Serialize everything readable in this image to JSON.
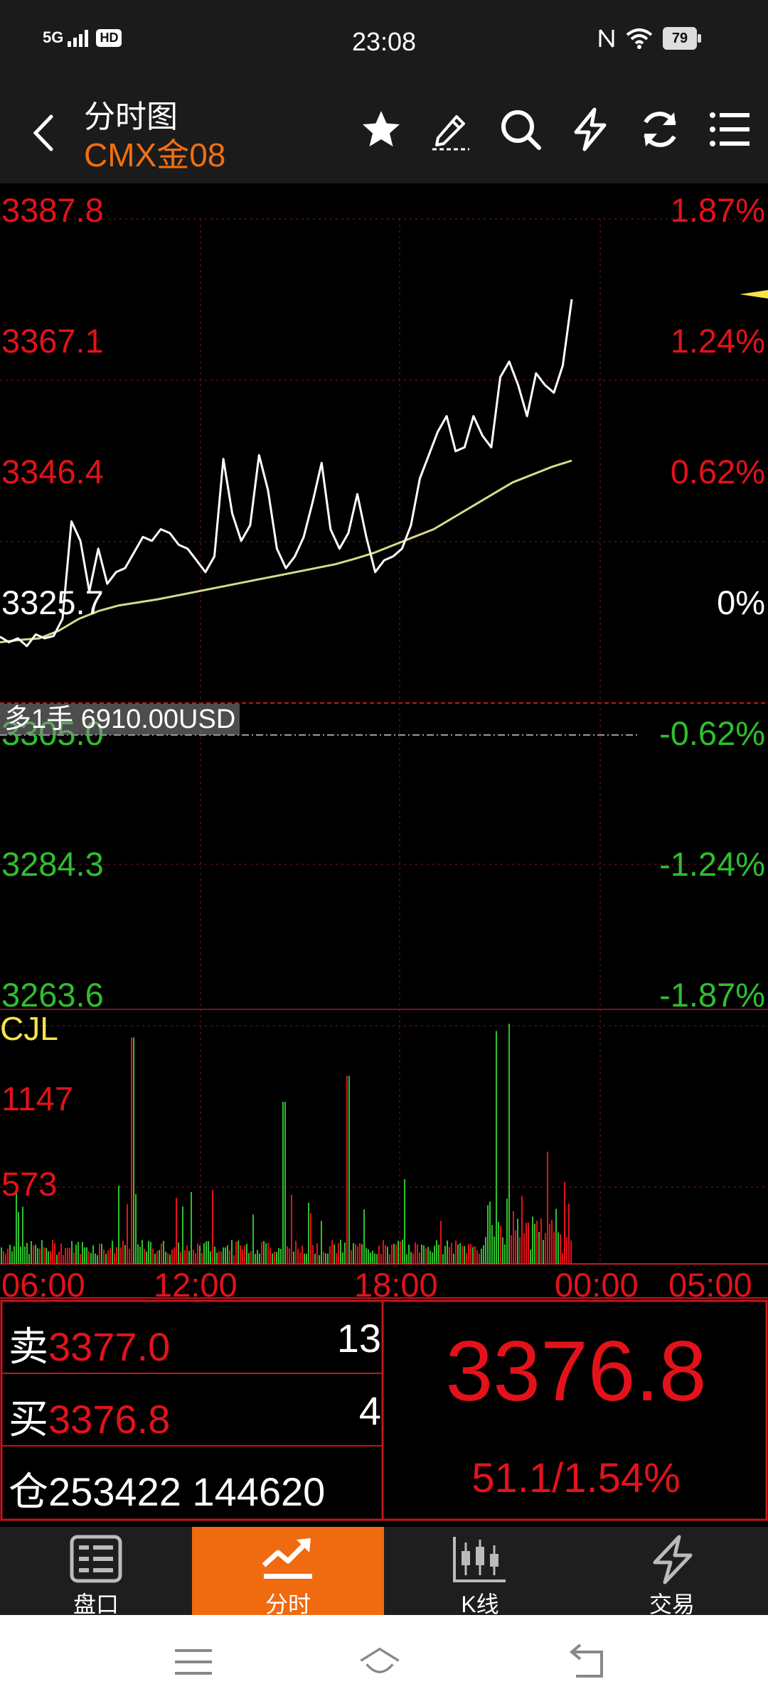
{
  "status_bar": {
    "network": "5G",
    "hd": "HD",
    "time": "23:08",
    "battery": "79"
  },
  "nav": {
    "title": "分时图",
    "subtitle": "CMX金08"
  },
  "chart": {
    "price_axis_left": [
      "3387.8",
      "3367.1",
      "3346.4",
      "3325.7",
      "3305.0",
      "3284.3",
      "3263.6"
    ],
    "percent_axis_right": [
      "1.87%",
      "1.24%",
      "0.62%",
      "0%",
      "-0.62%",
      "-1.24%",
      "-1.87%"
    ],
    "position_tag": "多1手  6910.00USD",
    "volume_label": "CJL",
    "volume_axis": [
      "1147",
      "573"
    ],
    "time_axis": [
      "06:00",
      "12:00",
      "18:00",
      "00:00",
      "05:00"
    ],
    "colors": {
      "up": "#e3121a",
      "down": "#2fbf2f",
      "price_line": "#ffffff",
      "avg_line": "#d7d98a",
      "accent": "#f06a0f"
    }
  },
  "chart_data": {
    "type": "line",
    "x_ticks": [
      "06:00",
      "12:00",
      "18:00",
      "00:00",
      "05:00"
    ],
    "ylim": [
      3263.6,
      3387.8
    ],
    "y_ticks": [
      3387.8,
      3367.1,
      3346.4,
      3325.7,
      3305.0,
      3284.3,
      3263.6
    ],
    "reference_price": 3325.7,
    "series": [
      {
        "values": [
          3334.2,
          3333.5,
          3334.0,
          3333.0,
          3334.5,
          3334.0,
          3334.3,
          3336.5,
          3349.0,
          3346.5,
          3340.0,
          3345.5,
          3341.0,
          3342.5,
          3343.0,
          3345.0,
          3347.0,
          3346.5,
          3348.0,
          3347.5,
          3346.0,
          3345.5,
          3344.0,
          3342.5,
          3344.5,
          3357.0,
          3350.0,
          3346.5,
          3348.5,
          3357.5,
          3353.0,
          3345.5,
          3343.0,
          3344.5,
          3347.0,
          3351.5,
          3356.5,
          3348.0,
          3345.5,
          3347.5,
          3352.5,
          3347.0,
          3342.5,
          3344.0,
          3344.5,
          3345.5,
          3348.5,
          3354.5,
          3357.5,
          3360.5,
          3362.5,
          3358.0,
          3358.5,
          3362.5,
          3360.0,
          3358.5,
          3367.5,
          3369.5,
          3366.5,
          3362.5,
          3368.0,
          3366.5,
          3365.5,
          3369.0,
          3377.5
        ]
      },
      {
        "values": [
          3333.5,
          3333.8,
          3334.0,
          3335.0,
          3336.5,
          3337.5,
          3338.2,
          3338.6,
          3339.0,
          3339.5,
          3340.0,
          3340.5,
          3341.0,
          3341.5,
          3342.0,
          3342.5,
          3343.0,
          3343.5,
          3344.2,
          3345.0,
          3346.0,
          3347.0,
          3348.0,
          3349.5,
          3351.0,
          3352.5,
          3354.0,
          3355.0,
          3356.0,
          3356.8
        ]
      }
    ],
    "volume": {
      "ylim": [
        0,
        1720
      ],
      "y_ticks": [
        1147,
        573
      ]
    }
  },
  "quote": {
    "ask_label": "卖",
    "ask_price": "3377.0",
    "ask_qty": "13",
    "bid_label": "买",
    "bid_price": "3376.8",
    "bid_qty": "4",
    "open_interest_label": "仓",
    "open_interest": "253422 144620",
    "last_price": "3376.8",
    "change": "51.1/1.54%"
  },
  "tabs": [
    {
      "label": "盘口",
      "icon": "order-book-icon"
    },
    {
      "label": "分时",
      "icon": "timeshare-icon"
    },
    {
      "label": "K线",
      "icon": "candlestick-icon"
    },
    {
      "label": "交易",
      "icon": "lightning-icon"
    }
  ]
}
